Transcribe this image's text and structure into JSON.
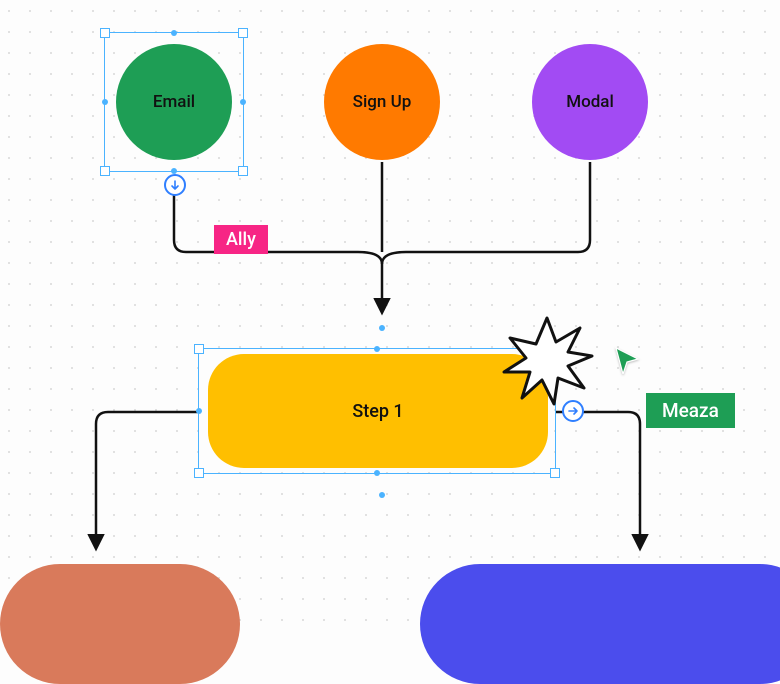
{
  "nodes": {
    "email": {
      "label": "Email"
    },
    "signup": {
      "label": "Sign Up"
    },
    "modal": {
      "label": "Modal"
    },
    "step1": {
      "label": "Step 1"
    }
  },
  "cursors": {
    "ally": {
      "name": "Ally",
      "color": "#F72585"
    },
    "meaza": {
      "name": "Meaza",
      "color": "#1E9E55"
    }
  }
}
